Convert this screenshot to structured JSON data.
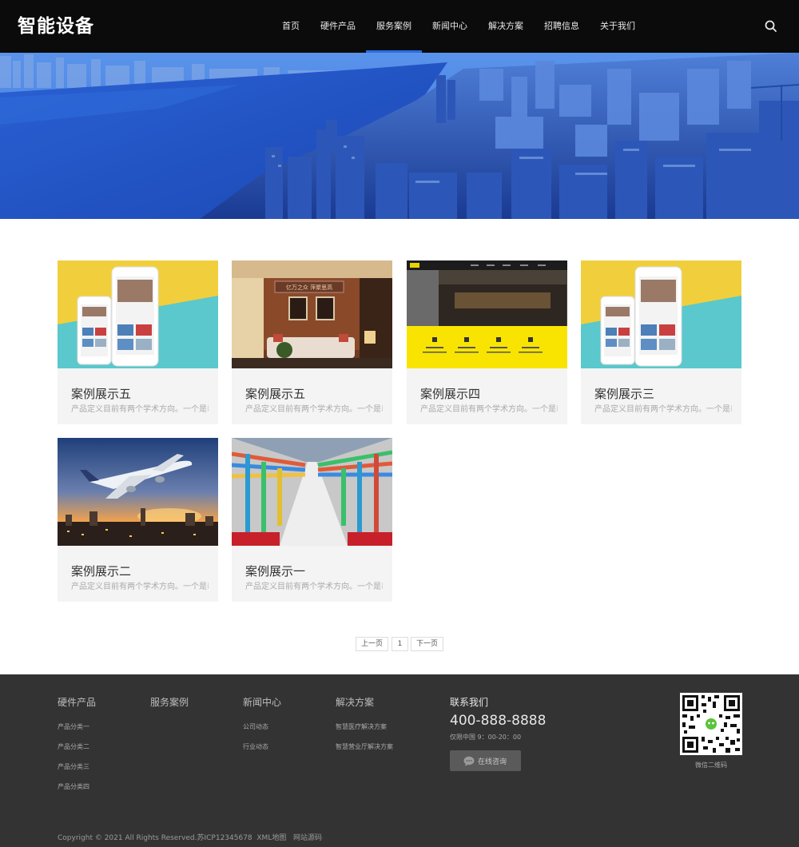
{
  "header": {
    "logo": "智能设备",
    "nav": [
      "首页",
      "硬件产品",
      "服务案例",
      "新闻中心",
      "解决方案",
      "招聘信息",
      "关于我们"
    ],
    "active_index": 2,
    "search_icon": "search-icon"
  },
  "cases": [
    {
      "title": "案例展示五",
      "desc": "产品定义目前有两个学术方向。一个是以",
      "image": "mobile-app-mockup"
    },
    {
      "title": "案例展示五",
      "desc": "产品定义目前有两个学术方向。一个是以",
      "image": "living-room-interior",
      "sign": "亿万之众  萍聚思高"
    },
    {
      "title": "案例展示四",
      "desc": "产品定义目前有两个学术方向。一个是以",
      "image": "website-mockup-yellow"
    },
    {
      "title": "案例展示三",
      "desc": "产品定义目前有两个学术方向。一个是以",
      "image": "mobile-app-mockup"
    },
    {
      "title": "案例展示二",
      "desc": "产品定义目前有两个学术方向。一个是以",
      "image": "airplane-sunset"
    },
    {
      "title": "案例展示一",
      "desc": "产品定义目前有两个学术方向。一个是以",
      "image": "factory-pipes"
    }
  ],
  "pagination": {
    "prev": "上一页",
    "current": "1",
    "next": "下一页"
  },
  "footer": {
    "columns": [
      {
        "title": "硬件产品",
        "links": [
          "产品分类一",
          "产品分类二",
          "产品分类三",
          "产品分类四"
        ]
      },
      {
        "title": "服务案例",
        "links": []
      },
      {
        "title": "新闻中心",
        "links": [
          "公司动态",
          "行业动态"
        ]
      },
      {
        "title": "解决方案",
        "links": [
          "智慧医疗解决方案",
          "智慧营业厅解决方案"
        ]
      }
    ],
    "contact": {
      "title": "联系我们",
      "phone": "400-888-8888",
      "hours": "仅限中国 9：00-20：00",
      "consult_label": "在线咨询"
    },
    "qr_label": "微信二维码",
    "copyright": "Copyright © 2021 All Rights Reserved.苏ICP12345678",
    "xml_map": "XML地图",
    "source_link": "网站源码"
  },
  "colors": {
    "header_bg": "#0b0b0b",
    "accent": "#2a6ee8",
    "footer_bg": "#333333",
    "card_bg": "#f4f4f4"
  }
}
